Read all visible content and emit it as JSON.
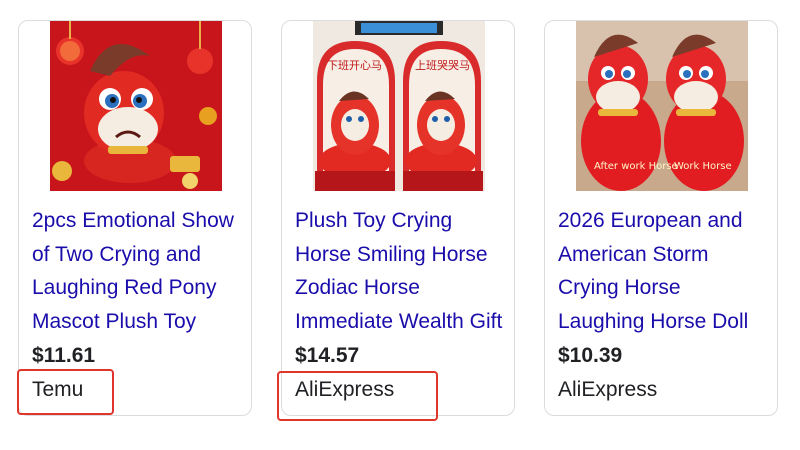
{
  "products": [
    {
      "title": "2pcs Emotional Show of Two Crying and Laughing Red Pony Mascot Plush Toy",
      "price": "$11.61",
      "source": "Temu",
      "image_icon": "red-plush-pony-image",
      "highlighted": true
    },
    {
      "title": "Plush Toy Crying Horse Smiling Horse Zodiac Horse Immediate Wealth Gift",
      "price": "$14.57",
      "source": "AliExpress",
      "image_icon": "two-plush-horses-in-gift-boxes-image",
      "image_text": [
        "下班开心马",
        "上班哭哭马"
      ],
      "highlighted": true
    },
    {
      "title": "2026 European and American Storm Crying Horse Laughing Horse Doll",
      "price": "$10.39",
      "source": "AliExpress",
      "image_icon": "two-red-plush-horses-image",
      "image_text": [
        "After work Horse",
        "Work Horse"
      ],
      "highlighted": false
    }
  ],
  "colors": {
    "title_link": "#1a0dab",
    "text": "#202124",
    "highlight_box": "#e0352b",
    "card_border": "#dadce0"
  }
}
